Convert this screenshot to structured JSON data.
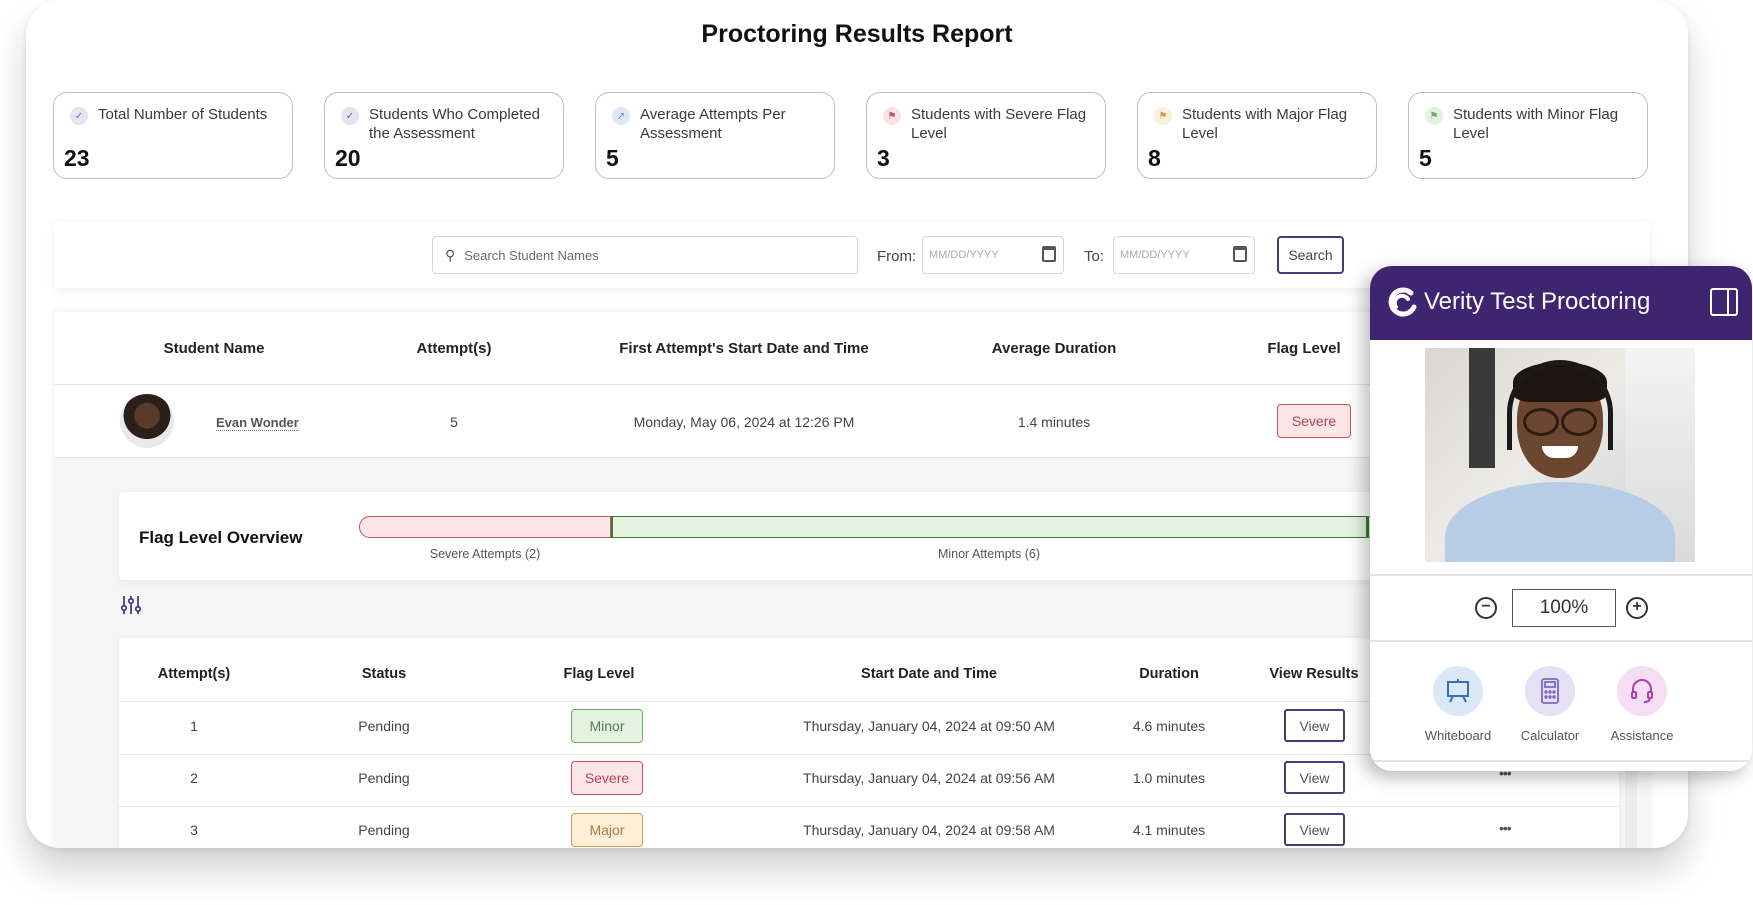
{
  "page": {
    "title": "Proctoring Results Report"
  },
  "stats": [
    {
      "label": "Total Number of Students",
      "value": "23",
      "icon": "check-circle-icon",
      "color": "#6a6aa8"
    },
    {
      "label": "Students Who Completed the Assessment",
      "value": "20",
      "icon": "check-circle-icon",
      "color": "#6a6aa8"
    },
    {
      "label": "Average Attempts Per Assessment",
      "value": "5",
      "icon": "trend-icon",
      "color": "#5a8ad0"
    },
    {
      "label": "Students with Severe Flag Level",
      "value": "3",
      "icon": "flag-icon",
      "color": "#c85060"
    },
    {
      "label": "Students with Major Flag Level",
      "value": "8",
      "icon": "flag-icon",
      "color": "#d49a55"
    },
    {
      "label": "Students with Minor Flag Level",
      "value": "5",
      "icon": "flag-icon",
      "color": "#6cad63"
    }
  ],
  "filters": {
    "search_placeholder": "Search Student Names",
    "from_label": "From:",
    "to_label": "To:",
    "from_placeholder": "MM/DD/YYYY",
    "to_placeholder": "MM/DD/YYYY",
    "search_button": "Search"
  },
  "students_table": {
    "headers": [
      "Student Name",
      "Attempt(s)",
      "First Attempt's Start Date and Time",
      "Average Duration",
      "Flag Level"
    ],
    "rows": [
      {
        "name": "Evan Wonder",
        "attempts": "5",
        "first_start": "Monday, May 06, 2024 at 12:26 PM",
        "avg_duration": "1.4 minutes",
        "flag": "Severe"
      }
    ]
  },
  "flag_overview": {
    "title": "Flag Level Overview",
    "segments": [
      {
        "label": "Severe Attempts (2)",
        "level": "severe",
        "count": 2
      },
      {
        "label": "Minor Attempts (6)",
        "level": "minor",
        "count": 6
      }
    ]
  },
  "attempts_table": {
    "headers": [
      "Attempt(s)",
      "Status",
      "Flag Level",
      "Start Date and Time",
      "Duration",
      "View Results"
    ],
    "view_label": "View",
    "rows": [
      {
        "attempt": "1",
        "status": "Pending",
        "flag": "Minor",
        "start": "Thursday, January 04, 2024 at 09:50 AM",
        "duration": "4.6 minutes"
      },
      {
        "attempt": "2",
        "status": "Pending",
        "flag": "Severe",
        "start": "Thursday, January 04, 2024 at 09:56 AM",
        "duration": "1.0 minutes"
      },
      {
        "attempt": "3",
        "status": "Pending",
        "flag": "Major",
        "start": "Thursday, January 04, 2024 at 09:58 AM",
        "duration": "4.1 minutes"
      }
    ],
    "more_label": "•••"
  },
  "proctor_panel": {
    "title": "Verity Test Proctoring",
    "header_color": "#3f2470",
    "zoom_value": "100%",
    "tools": [
      {
        "label": "Whiteboard",
        "icon": "whiteboard-icon",
        "bg": "#dbe8f8",
        "color": "#3a6fb5"
      },
      {
        "label": "Calculator",
        "icon": "calculator-icon",
        "bg": "#e6e0f7",
        "color": "#7a6ac0"
      },
      {
        "label": "Assistance",
        "icon": "headset-icon",
        "bg": "#f5def4",
        "color": "#b03cb0"
      }
    ]
  }
}
